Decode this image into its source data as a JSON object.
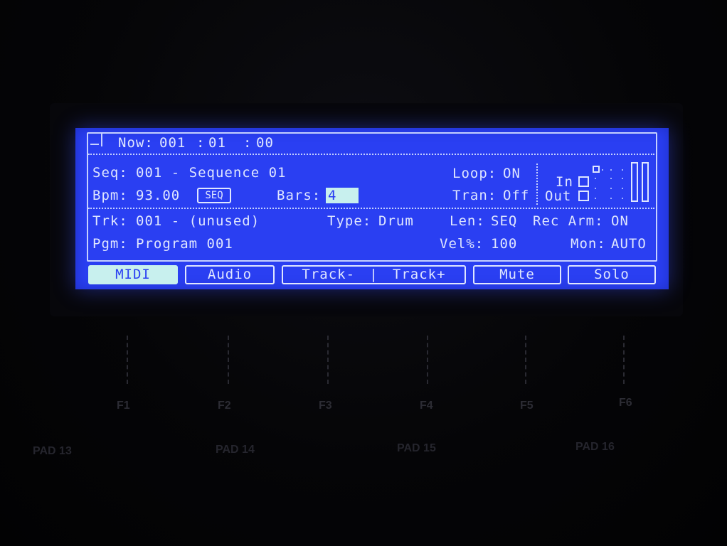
{
  "header": {
    "now_label": "Now:",
    "now_bar": "001",
    "now_sep1": ":",
    "now_beat": "01",
    "now_sep2": ":",
    "now_tick": "00"
  },
  "sequence": {
    "seq_label": "Seq:",
    "seq_value": "001 - Sequence 01",
    "bpm_label": "Bpm:",
    "bpm_value": "93.00",
    "bpm_source": "SEQ",
    "bars_label": "Bars:",
    "bars_value": "4",
    "loop_label": "Loop:",
    "loop_value": "ON",
    "tran_label": "Tran:",
    "tran_value": "Off",
    "in_label": "In",
    "out_label": "Out"
  },
  "track": {
    "trk_label": "Trk:",
    "trk_value": "001 - (unused)",
    "type_label": "Type:",
    "type_value": "Drum",
    "len_label": "Len:",
    "len_value": "SEQ",
    "rec_arm_label": "Rec Arm:",
    "rec_arm_value": "ON",
    "pgm_label": "Pgm:",
    "pgm_value": "Program 001",
    "vel_label": "Vel%:",
    "vel_value": "100",
    "mon_label": "Mon:",
    "mon_value": "AUTO"
  },
  "softkeys": {
    "midi": "MIDI",
    "audio": "Audio",
    "track_minus": "Track-",
    "track_separator": "|",
    "track_plus": "Track+",
    "mute": "Mute",
    "solo": "Solo"
  },
  "function_keys": [
    "F1",
    "F2",
    "F3",
    "F4",
    "F5",
    "F6"
  ],
  "pads": [
    "PAD 13",
    "PAD 14",
    "PAD 15",
    "PAD 16"
  ],
  "colors": {
    "lcd_background": "#2a3ff2",
    "lcd_text": "#dfe6ff",
    "highlight": "#c8f0ee",
    "body": "#040406"
  }
}
